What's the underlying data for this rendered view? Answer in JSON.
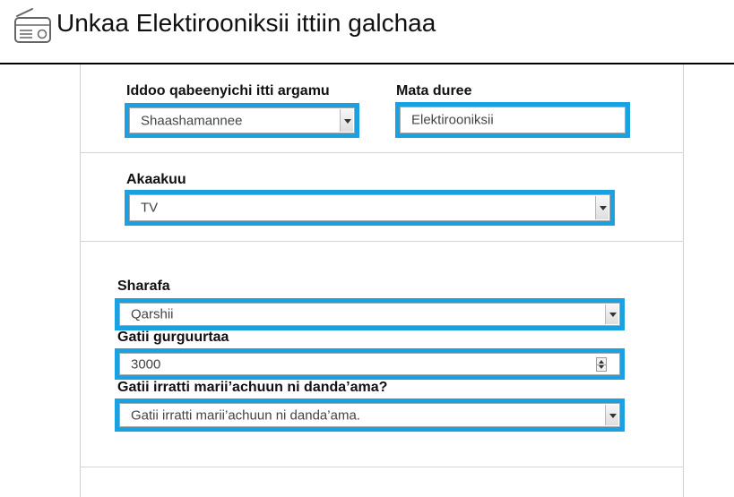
{
  "header": {
    "icon": "radio-icon",
    "title": "Unkaa Elektirooniksii ittiin galchaa"
  },
  "section1": {
    "location_label": "Iddoo qabeenyichi itti argamu",
    "location_value": "Shaashamannee",
    "origin_label": "Mata duree",
    "origin_value": "Elektirooniksii"
  },
  "section2": {
    "type_label": "Akaakuu",
    "type_value": "TV"
  },
  "section3": {
    "condition_label": "Sharafa",
    "condition_value": "Qarshii",
    "price_label": "Gatii gurguurtaa",
    "price_value": "3000",
    "negotiable_label": "Gatii irratti marii’achuun ni danda’ama?",
    "negotiable_value": "Gatii irratti marii’achuun ni danda’ama."
  },
  "colors": {
    "accent_border": "#1ba0e2",
    "text": "#111111"
  }
}
